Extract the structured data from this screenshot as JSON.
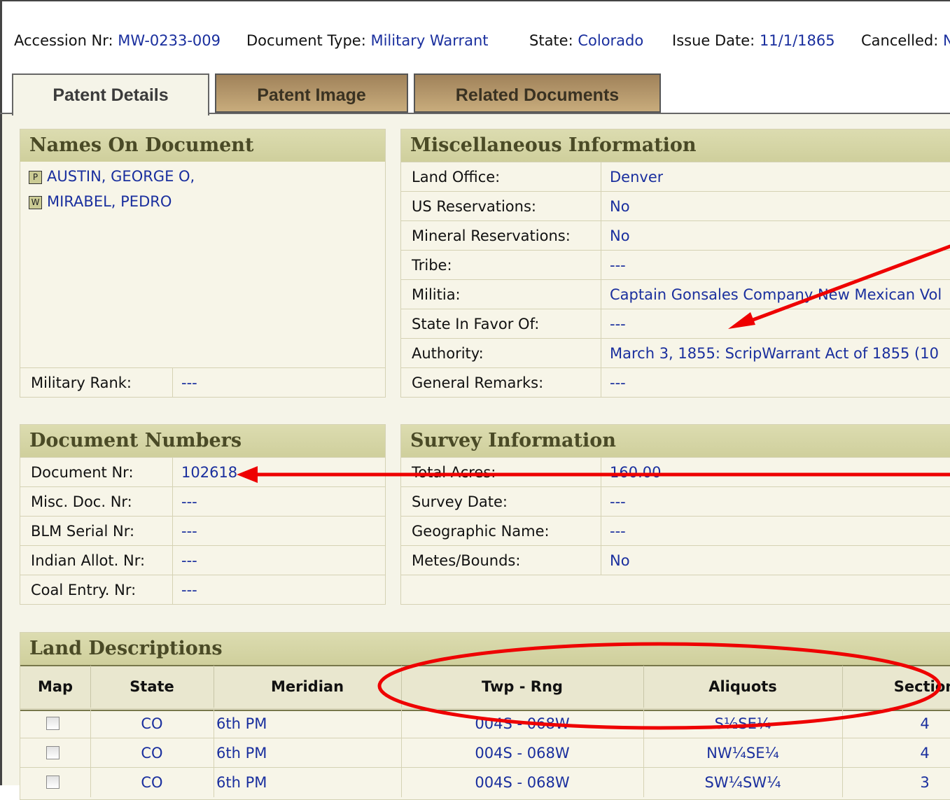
{
  "header": {
    "accession_label": "Accession Nr:",
    "accession_value": "MW-0233-009",
    "doctype_label": "Document Type:",
    "doctype_value": "Military Warrant",
    "state_label": "State:",
    "state_value": "Colorado",
    "issue_label": "Issue Date:",
    "issue_value": "11/1/1865",
    "cancelled_label": "Cancelled:",
    "cancelled_value": "N"
  },
  "tabs": [
    {
      "label": "Patent Details"
    },
    {
      "label": "Patent Image"
    },
    {
      "label": "Related Documents"
    }
  ],
  "names_panel": {
    "title": "Names On Document",
    "names": [
      {
        "badge": "P",
        "name": "AUSTIN, GEORGE O,"
      },
      {
        "badge": "W",
        "name": "MIRABEL, PEDRO"
      }
    ],
    "military_rank_label": "Military Rank:",
    "military_rank_value": "---"
  },
  "misc_panel": {
    "title": "Miscellaneous Information",
    "rows": [
      {
        "label": "Land Office:",
        "value": "Denver"
      },
      {
        "label": "US Reservations:",
        "value": "No"
      },
      {
        "label": "Mineral Reservations:",
        "value": "No"
      },
      {
        "label": "Tribe:",
        "value": "---"
      },
      {
        "label": "Militia:",
        "value": "Captain Gonsales Company New Mexican Vol"
      },
      {
        "label": "State In Favor Of:",
        "value": "---"
      },
      {
        "label": "Authority:",
        "value": "March 3, 1855: ScripWarrant Act of 1855 (10"
      },
      {
        "label": "General Remarks:",
        "value": "---"
      }
    ]
  },
  "docnum_panel": {
    "title": "Document Numbers",
    "rows": [
      {
        "label": "Document Nr:",
        "value": "102618"
      },
      {
        "label": "Misc. Doc. Nr:",
        "value": "---"
      },
      {
        "label": "BLM Serial Nr:",
        "value": "---"
      },
      {
        "label": "Indian Allot. Nr:",
        "value": "---"
      },
      {
        "label": "Coal Entry. Nr:",
        "value": "---"
      }
    ]
  },
  "survey_panel": {
    "title": "Survey Information",
    "rows": [
      {
        "label": "Total Acres:",
        "value": "160.00"
      },
      {
        "label": "Survey Date:",
        "value": "---"
      },
      {
        "label": "Geographic Name:",
        "value": "---"
      },
      {
        "label": "Metes/Bounds:",
        "value": "No"
      }
    ]
  },
  "land_panel": {
    "title": "Land Descriptions",
    "columns": [
      "Map",
      "State",
      "Meridian",
      "Twp - Rng",
      "Aliquots",
      "Section"
    ],
    "rows": [
      {
        "map_checked": false,
        "state": "CO",
        "meridian": "6th PM",
        "twp_rng": "004S - 068W",
        "aliquots": "S½SE¼",
        "section": "4"
      },
      {
        "map_checked": false,
        "state": "CO",
        "meridian": "6th PM",
        "twp_rng": "004S - 068W",
        "aliquots": "NW¼SE¼",
        "section": "4"
      },
      {
        "map_checked": false,
        "state": "CO",
        "meridian": "6th PM",
        "twp_rng": "004S - 068W",
        "aliquots": "SW¼SW¼",
        "section": "3"
      }
    ]
  },
  "colors": {
    "link": "#1a2f9e",
    "panel_header": "#d6d6a6",
    "panel_bg": "#f7f5e8",
    "tab_inactive": "#b8996a",
    "annotation": "#ee0000"
  }
}
